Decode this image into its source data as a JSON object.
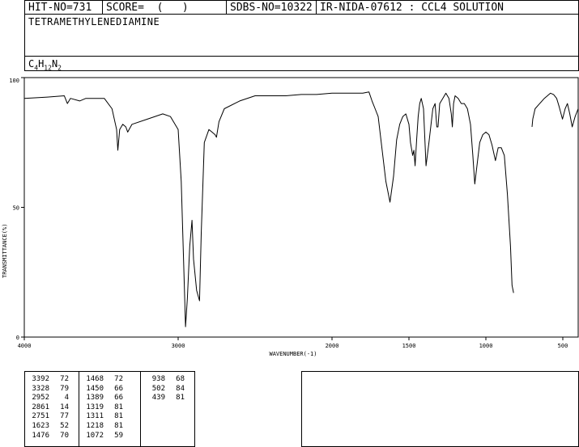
{
  "header": {
    "hit_no": "HIT-NO=731",
    "score": "SCORE=  (   )",
    "sdbs_no": "SDBS-NO=10322",
    "ir_id": "IR-NIDA-07612 : CCL4 SOLUTION"
  },
  "compound": {
    "name": "TETRAMETHYLENEDIAMINE",
    "formula_parts": [
      "C",
      "4",
      "H",
      "12",
      "N",
      "2"
    ]
  },
  "chart_data": {
    "type": "line",
    "xlabel": "WAVENUMBER(-1)",
    "ylabel": "TRANSMITTANCE(%)",
    "xlim": [
      4000,
      400
    ],
    "ylim": [
      0,
      100
    ],
    "x_ticks": [
      4000,
      3000,
      2000,
      1500,
      1000,
      500
    ],
    "x_tick_labels": [
      "4000",
      "3000",
      "2000",
      "1500",
      "1000",
      "500"
    ],
    "y_ticks": [
      0,
      50,
      100
    ],
    "y_tick_labels": [
      "0",
      "50",
      "100"
    ],
    "grid": false,
    "series": [
      {
        "segments": [
          [
            [
              4000,
              92
            ],
            [
              3850,
              92.5
            ],
            [
              3740,
              93
            ],
            [
              3720,
              90
            ],
            [
              3700,
              92
            ],
            [
              3640,
              91
            ],
            [
              3600,
              92
            ],
            [
              3480,
              92
            ],
            [
              3430,
              88
            ],
            [
              3400,
              80
            ],
            [
              3392,
              72
            ],
            [
              3380,
              80
            ],
            [
              3360,
              82
            ],
            [
              3340,
              81
            ],
            [
              3328,
              79
            ],
            [
              3300,
              82
            ],
            [
              3200,
              84
            ],
            [
              3100,
              86
            ],
            [
              3050,
              85
            ],
            [
              3000,
              80
            ],
            [
              2980,
              60
            ],
            [
              2960,
              20
            ],
            [
              2952,
              4
            ],
            [
              2940,
              15
            ],
            [
              2925,
              35
            ],
            [
              2910,
              45
            ],
            [
              2900,
              30
            ],
            [
              2880,
              18
            ],
            [
              2861,
              14
            ],
            [
              2850,
              40
            ],
            [
              2830,
              75
            ],
            [
              2800,
              80
            ],
            [
              2780,
              79
            ],
            [
              2760,
              78
            ],
            [
              2751,
              77
            ],
            [
              2735,
              83
            ],
            [
              2700,
              88
            ],
            [
              2600,
              91
            ],
            [
              2500,
              93
            ],
            [
              2400,
              93
            ],
            [
              2300,
              93
            ],
            [
              2200,
              93.5
            ],
            [
              2100,
              93.5
            ],
            [
              2000,
              94
            ],
            [
              1900,
              94
            ],
            [
              1800,
              94
            ],
            [
              1760,
              94.5
            ],
            [
              1740,
              91
            ],
            [
              1720,
              88
            ],
            [
              1700,
              85
            ],
            [
              1680,
              75
            ],
            [
              1650,
              60
            ],
            [
              1623,
              52
            ],
            [
              1600,
              62
            ],
            [
              1580,
              76
            ],
            [
              1560,
              82
            ],
            [
              1540,
              85
            ],
            [
              1520,
              86
            ],
            [
              1500,
              82
            ],
            [
              1490,
              75
            ],
            [
              1476,
              70
            ],
            [
              1468,
              72
            ],
            [
              1460,
              66
            ],
            [
              1450,
              76
            ],
            [
              1440,
              85
            ],
            [
              1430,
              90
            ],
            [
              1420,
              92
            ],
            [
              1405,
              88
            ],
            [
              1389,
              66
            ],
            [
              1370,
              75
            ],
            [
              1345,
              88
            ],
            [
              1330,
              90
            ],
            [
              1319,
              81
            ],
            [
              1311,
              81
            ],
            [
              1300,
              90
            ],
            [
              1280,
              92
            ],
            [
              1260,
              94
            ],
            [
              1240,
              92
            ],
            [
              1225,
              86
            ],
            [
              1218,
              81
            ],
            [
              1210,
              90
            ],
            [
              1200,
              93
            ],
            [
              1180,
              92
            ],
            [
              1160,
              90
            ],
            [
              1140,
              90
            ],
            [
              1120,
              88
            ],
            [
              1100,
              82
            ],
            [
              1085,
              70
            ],
            [
              1072,
              59
            ],
            [
              1060,
              65
            ],
            [
              1040,
              75
            ],
            [
              1020,
              78
            ],
            [
              1000,
              79
            ],
            [
              980,
              78
            ],
            [
              960,
              74
            ],
            [
              938,
              68
            ],
            [
              920,
              73
            ],
            [
              900,
              73
            ],
            [
              880,
              70
            ],
            [
              860,
              55
            ],
            [
              840,
              35
            ],
            [
              830,
              20
            ],
            [
              820,
              17
            ]
          ],
          [
            [
              700,
              81
            ],
            [
              695,
              84
            ],
            [
              680,
              88
            ],
            [
              650,
              90
            ],
            [
              620,
              92
            ],
            [
              600,
              93
            ],
            [
              580,
              94
            ],
            [
              560,
              93.5
            ],
            [
              540,
              92
            ],
            [
              525,
              89
            ],
            [
              502,
              84
            ],
            [
              485,
              88
            ],
            [
              470,
              90
            ],
            [
              455,
              86
            ],
            [
              439,
              81
            ],
            [
              420,
              85
            ],
            [
              400,
              88
            ]
          ]
        ]
      }
    ]
  },
  "peak_table": {
    "columns": [
      [
        [
          "3392",
          "72"
        ],
        [
          "3328",
          "79"
        ],
        [
          "2952",
          "4"
        ],
        [
          "2861",
          "14"
        ],
        [
          "2751",
          "77"
        ],
        [
          "1623",
          "52"
        ],
        [
          "1476",
          "70"
        ]
      ],
      [
        [
          "1468",
          "72"
        ],
        [
          "1450",
          "66"
        ],
        [
          "1389",
          "66"
        ],
        [
          "1319",
          "81"
        ],
        [
          "1311",
          "81"
        ],
        [
          "1218",
          "81"
        ],
        [
          "1072",
          "59"
        ]
      ],
      [
        [
          "938",
          "68"
        ],
        [
          "502",
          "84"
        ],
        [
          "439",
          "81"
        ]
      ]
    ]
  }
}
